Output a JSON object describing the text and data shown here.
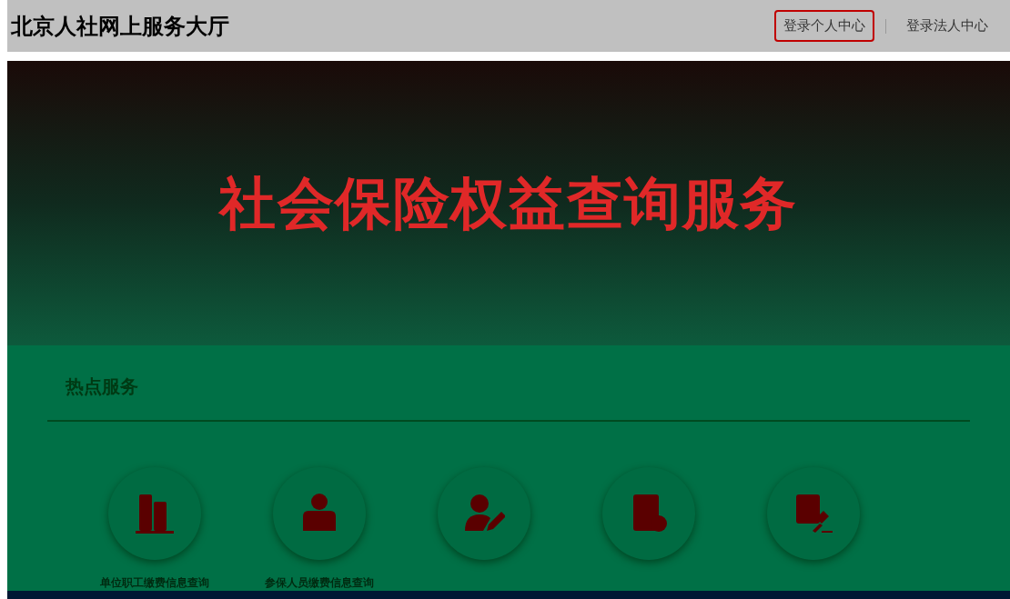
{
  "header": {
    "site_title": "北京人社网上服务大厅",
    "links": [
      {
        "label": "登录个人中心",
        "selected": true
      },
      {
        "label": "登录法人中心",
        "selected": false
      }
    ]
  },
  "banner": {
    "title": "社会保险权益查询服务"
  },
  "hot_services": {
    "heading": "热点服务",
    "items": [
      {
        "kind": "building",
        "label": "单位职工缴费信息查询"
      },
      {
        "kind": "person",
        "label": "参保人员缴费信息查询"
      },
      {
        "kind": "edit"
      },
      {
        "kind": "document"
      },
      {
        "kind": "gavel"
      }
    ]
  }
}
